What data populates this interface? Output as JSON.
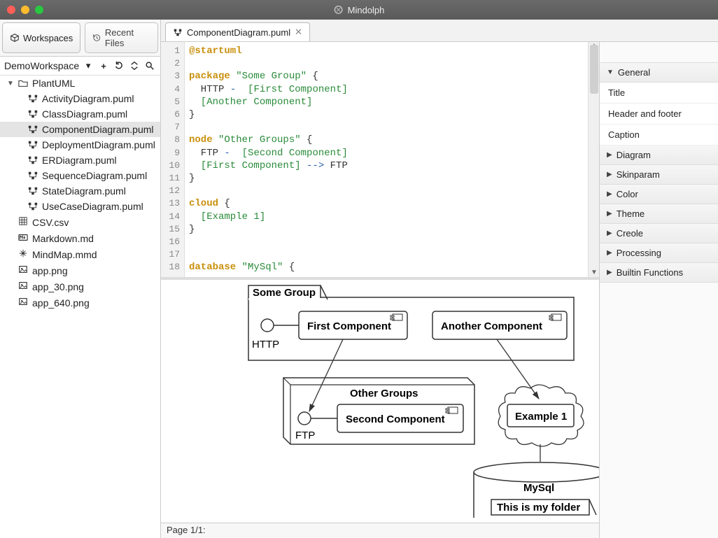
{
  "app": {
    "title": "Mindolph"
  },
  "leftTabs": {
    "workspaces": "Workspaces",
    "recent": "Recent Files"
  },
  "workspace": {
    "name": "DemoWorkspace"
  },
  "tree": {
    "root": "PlantUML",
    "pumlFiles": [
      "ActivityDiagram.puml",
      "ClassDiagram.puml",
      "ComponentDiagram.puml",
      "DeploymentDiagram.puml",
      "ERDiagram.puml",
      "SequenceDiagram.puml",
      "StateDiagram.puml",
      "UseCaseDiagram.puml"
    ],
    "selectedIndex": 2,
    "otherFiles": [
      {
        "icon": "grid",
        "name": "CSV.csv"
      },
      {
        "icon": "md",
        "name": "Markdown.md"
      },
      {
        "icon": "mind",
        "name": "MindMap.mmd"
      },
      {
        "icon": "img",
        "name": "app.png"
      },
      {
        "icon": "img",
        "name": "app_30.png"
      },
      {
        "icon": "img",
        "name": "app_640.png"
      }
    ]
  },
  "editorTab": {
    "label": "ComponentDiagram.puml"
  },
  "code": {
    "lineStart": 1,
    "lineEnd": 18,
    "l1a": "@startuml",
    "l3a": "package",
    "l3b": " \"Some Group\"",
    "l3c": " {",
    "l4a": "  HTTP",
    "l4b": " - ",
    "l4c": " [First Component]",
    "l5a": "  [Another Component]",
    "l6a": "}",
    "l8a": "node",
    "l8b": " \"Other Groups\"",
    "l8c": " {",
    "l9a": "  FTP",
    "l9b": " - ",
    "l9c": " [Second Component]",
    "l10a": "  [First Component]",
    "l10b": " --> ",
    "l10c": "FTP",
    "l11a": "}",
    "l13a": "cloud",
    "l13b": " {",
    "l14a": "  [Example 1]",
    "l15a": "}",
    "l18a": "database",
    "l18b": " \"MySql\"",
    "l18c": " {"
  },
  "diagram": {
    "group1": "Some Group",
    "comp1": "First Component",
    "comp2": "Another Component",
    "port1": "HTTP",
    "group2": "Other Groups",
    "comp3": "Second Component",
    "port2": "FTP",
    "cloud1": "Example 1",
    "db": "MySql",
    "folder": "This is my folder"
  },
  "status": {
    "page": "Page 1/1:"
  },
  "sidebar": {
    "general": "General",
    "generalItems": [
      "Title",
      "Header and footer",
      "Caption"
    ],
    "sections": [
      "Diagram",
      "Skinparam",
      "Color",
      "Theme",
      "Creole",
      "Processing",
      "Builtin Functions"
    ]
  }
}
